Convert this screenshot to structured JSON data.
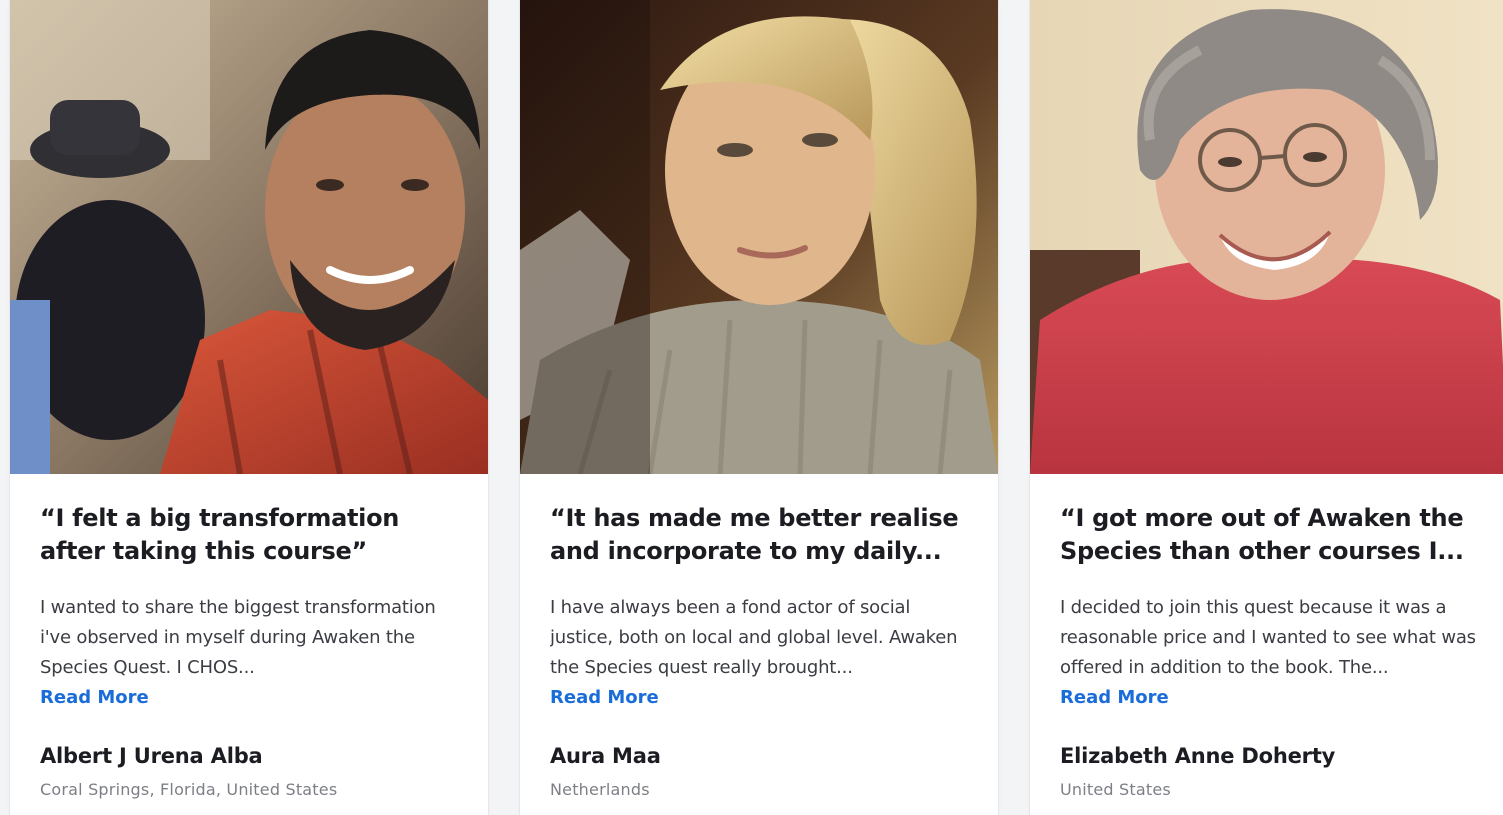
{
  "testimonials": [
    {
      "quote": "“I felt a big transformation after taking this course”",
      "excerpt": "I wanted to share the biggest transformation i've observed in myself during Awaken the Species Quest. I CHOS...",
      "read_more": "Read More",
      "name": "Albert J Urena Alba",
      "location": "Coral Springs, Florida, United States",
      "photo_alt": "Smiling bearded man in a red plaid shirt"
    },
    {
      "quote": "“It has made me better realise and incorporate to my daily...",
      "excerpt": "I have always been a fond actor of social justice, both on local and global level. Awaken the Species quest really brought...",
      "read_more": "Read More",
      "name": "Aura Maa",
      "location": "Netherlands",
      "photo_alt": "Blonde woman in a grey knit sweater"
    },
    {
      "quote": "“I got more out of Awaken the Species than other courses I...",
      "excerpt": "I decided to join this quest because it was a reasonable price and I wanted to see what was offered in addition to the book. The...",
      "read_more": "Read More",
      "name": "Elizabeth Anne Doherty",
      "location": "United States",
      "photo_alt": "Smiling grey-haired woman with glasses in a red sweater"
    }
  ],
  "colors": {
    "link": "#1a6cd8",
    "heading": "#1c1d22",
    "muted": "#7d7f86"
  }
}
